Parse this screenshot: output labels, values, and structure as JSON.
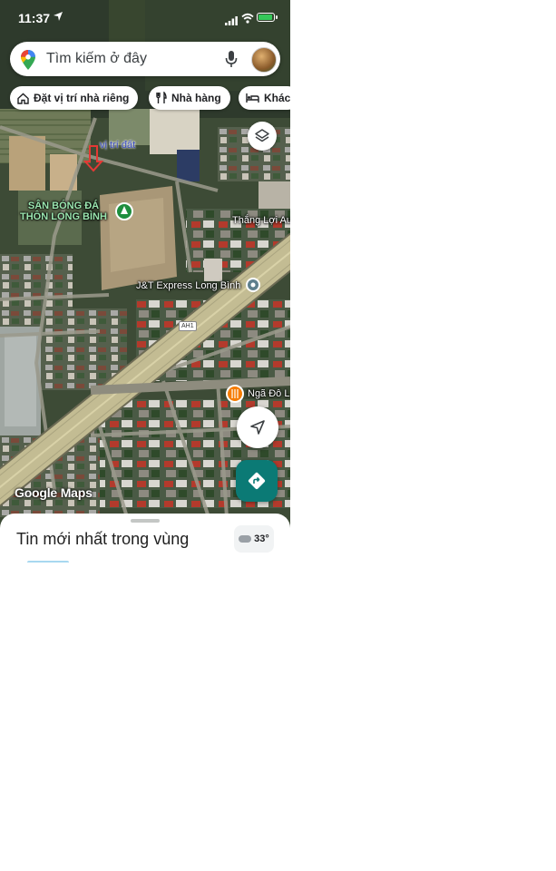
{
  "status_bar": {
    "time": "11:37"
  },
  "search": {
    "placeholder": "Tìm kiếm ở đây"
  },
  "chips": [
    {
      "label": "Đặt vị trí nhà riêng",
      "icon": "home-icon"
    },
    {
      "label": "Nhà hàng",
      "icon": "fork-knife-icon"
    },
    {
      "label": "Khác",
      "icon": "bed-icon"
    }
  ],
  "map": {
    "annotation": "vị trí đất",
    "places": {
      "football_field_line1": "SÂN BÓNG ĐÁ",
      "football_field_line2": "THÔN LONG BÌNH",
      "thang_loi": "Thắng Lợi Au",
      "jt_express": "J&T Express Long Bình",
      "road_shield": "AH1",
      "nga_do": "Ngã Đô L"
    },
    "logo": "Google Maps",
    "colors": {
      "annotation_arrow": "#e53935",
      "directions_fab": "#0b7a75",
      "restaurant_pin": "#f57c00"
    }
  },
  "bottom_sheet": {
    "title": "Tin mới nhất trong vùng",
    "temperature": "33°"
  }
}
